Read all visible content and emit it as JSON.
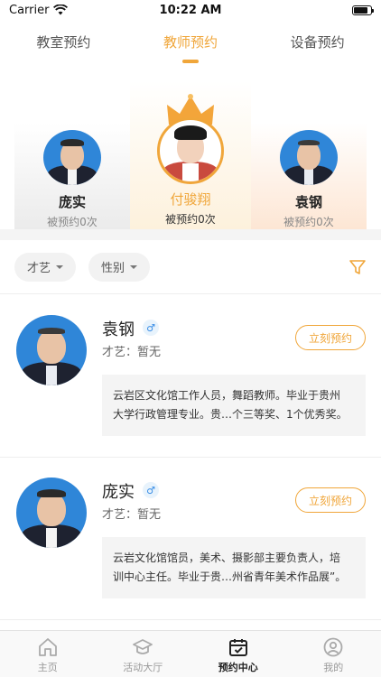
{
  "status_bar": {
    "carrier": "Carrier",
    "time": "10:22 AM",
    "battery_level": 0.85
  },
  "top_tabs": [
    {
      "label": "教室预约",
      "active": false
    },
    {
      "label": "教师预约",
      "active": true
    },
    {
      "label": "设备预约",
      "active": false
    }
  ],
  "carousel": [
    {
      "name": "庞实",
      "count": "被预约0次"
    },
    {
      "name": "付骏翔",
      "count": "被预约0次"
    },
    {
      "name": "袁钢",
      "count": "被预约0次"
    }
  ],
  "filters": {
    "talent_label": "才艺",
    "gender_label": "性别"
  },
  "teachers": [
    {
      "name": "袁钢",
      "gender_symbol": "♂",
      "talent": "才艺：暂无",
      "button": "立刻预约",
      "intro_line1": "云岩区文化馆工作人员，舞蹈教师。毕业于贵州",
      "intro_line2": "大学行政管理专业。贵…个三等奖、1个优秀奖。"
    },
    {
      "name": "庞实",
      "gender_symbol": "♂",
      "talent": "才艺：暂无",
      "button": "立刻预约",
      "intro_line1": "云岩文化馆馆员，美术、摄影部主要负责人，培",
      "intro_line2": "训中心主任。毕业于贵…州省青年美术作品展”。"
    }
  ],
  "bottom_nav": [
    {
      "label": "主页",
      "icon": "home-icon",
      "active": false
    },
    {
      "label": "活动大厅",
      "icon": "graduation-cap-icon",
      "active": false
    },
    {
      "label": "预约中心",
      "icon": "calendar-check-icon",
      "active": true
    },
    {
      "label": "我的",
      "icon": "user-icon",
      "active": false
    }
  ],
  "colors": {
    "accent": "#f0a63a",
    "avatar_bg": "#2f86d8",
    "band": "#f4f4f4"
  }
}
